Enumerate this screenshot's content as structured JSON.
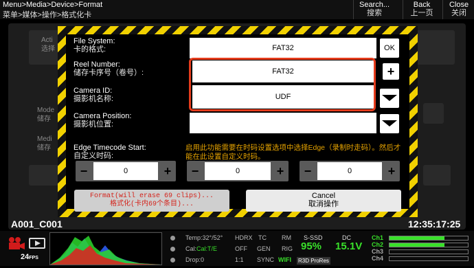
{
  "topbar": {
    "crumb_en": "Menu>Media>Device>Format",
    "crumb_cn": "菜单>媒体>操作>格式化卡",
    "search_en": "Search...",
    "search_cn": "搜索",
    "back_en": "Back",
    "back_cn": "上一页",
    "close_en": "Close",
    "close_cn": "关闭"
  },
  "background": {
    "row1_en": "Acti",
    "row1_cn": "选择",
    "row2_en": "Mode",
    "row2_cn": "储存",
    "row3_en": "Medi",
    "row3_cn": "储存"
  },
  "dialog": {
    "fs_label_en": "File System:",
    "fs_label_cn": "卡的格式:",
    "fs_value": "FAT32",
    "ok_label": "OK",
    "reel_label_en": "Reel Number:",
    "reel_label_cn": "储存卡序号（卷号）:",
    "reel_value": "FAT32",
    "camid_label_en": "Camera ID:",
    "camid_label_cn": "摄影机名称:",
    "camid_value": "UDF",
    "campos_label_en": "Camera Position:",
    "campos_label_cn": "摄影机位置:",
    "campos_value": "",
    "tc_label_en": "Edge Timecode Start:",
    "tc_label_cn": "自定义时码:",
    "hint": "启用此功能需要在时码设置选项中选择Edge（录制时走码）。然后才能在此设置自定义时码。",
    "steppers": [
      {
        "minus": "−",
        "value": "0",
        "plus": "+"
      },
      {
        "minus": "−",
        "value": "0",
        "plus": "+"
      },
      {
        "minus": "−",
        "value": "0",
        "plus": "+"
      }
    ],
    "format_en": "Format(will erase 69 clips)...",
    "format_cn": "格式化(卡内69个条目)...",
    "cancel_en": "Cancel",
    "cancel_cn": "取消操作",
    "plus_label": "+"
  },
  "clip": {
    "name": "A001_C001",
    "timecode": "12:35:17:25"
  },
  "status": {
    "fps": "24",
    "fps_unit": "FPS",
    "temp": "Temp:32°/52°",
    "cal": "Cal:T/E",
    "drop": "Drop:0",
    "hdrx": "HDRX",
    "hdrx_val": "OFF",
    "ratio": "1:1",
    "tc": "TC",
    "tc_val": "GEN",
    "sync": "SYNC",
    "rm": "RM",
    "rm_val": "RIG",
    "wifi": "WIFI",
    "ssd": "S-SSD",
    "ssd_val": "95%",
    "codec": "R3D ProRes",
    "dc": "DC",
    "dc_val": "15.1V",
    "ch1": "Ch1",
    "ch2": "Ch2",
    "ch3": "Ch3",
    "ch4": "Ch4"
  },
  "colors": {
    "accent_red": "#e53c1d",
    "hazard_yellow": "#f1d100",
    "status_green": "#39e02a",
    "hint_orange": "#e6a300"
  }
}
